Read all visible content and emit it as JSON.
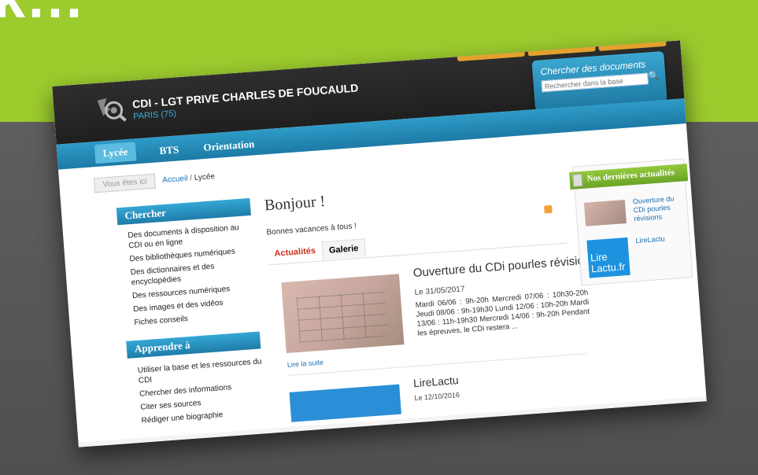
{
  "slide": {
    "heading_fragment": "k..."
  },
  "site": {
    "title": "CDI - LGT PRIVE CHARLES DE FOUCAULD",
    "subtitle": "PARIS (75)"
  },
  "search": {
    "title": "Chercher des documents",
    "placeholder": "Rechercher dans la base"
  },
  "nav": {
    "items": [
      {
        "label": "Lycée"
      },
      {
        "label": "BTS"
      },
      {
        "label": "Orientation"
      }
    ]
  },
  "breadcrumb": {
    "here": "Vous êtes ici",
    "home": "Accueil",
    "separator": "/",
    "current": "Lycée"
  },
  "sidebar": {
    "sections": [
      {
        "title": "Chercher",
        "items": [
          "Des documents à disposition au CDI ou en ligne",
          "Des bibliothèques numériques",
          "Des dictionnaires et des encyclopédies",
          "Des ressources numériques",
          "Des images et des vidéos",
          "Fiches conseils"
        ]
      },
      {
        "title": "Apprendre à",
        "items": [
          "Utiliser la base et les ressources du CDI",
          "Chercher des informations",
          "Citer ses sources",
          "Rédiger une biographie"
        ]
      }
    ]
  },
  "main": {
    "title": "Bonjour !",
    "greeting": "Bonnes vacances à tous !",
    "tabs": [
      {
        "label": "Actualités"
      },
      {
        "label": "Galerie"
      }
    ],
    "articles": [
      {
        "title": "Ouverture du CDi pourles révisions",
        "date": "Le 31/05/2017",
        "excerpt": "Mardi 06/06 : 9h-20h Mercredi 07/06 : 10h30-20h Jeudi 08/06 : 9h-19h30 Lundi 12/06 : 10h-20h Mardi 13/06 : 11h-19h30 Mercredi 14/06 : 9h-20h Pendant les épreuves, le CDi restera ...",
        "read_more": "Lire la suite"
      },
      {
        "title": "LireLactu",
        "date": "Le 12/10/2016"
      }
    ]
  },
  "news": {
    "title": "Nos dernières actualités",
    "items": [
      {
        "title": "Ouverture du CDi pourles révisions"
      },
      {
        "title": "LireLactu",
        "thumb_line1": "Lire",
        "thumb_line2": "Lactu.fr"
      }
    ]
  }
}
